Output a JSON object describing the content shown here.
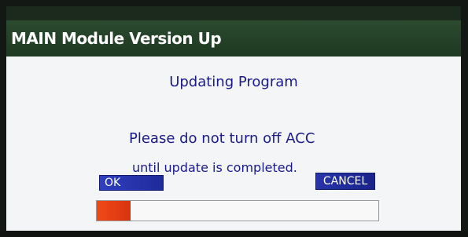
{
  "window": {
    "title": "MAIN Module Version Up"
  },
  "dialog": {
    "heading": "Updating Program",
    "message_line1": "Please do not turn off ACC",
    "message_line2": "until update is completed."
  },
  "buttons": {
    "ok_label": "OK",
    "cancel_label": "CANCEL"
  },
  "progress": {
    "value": 0.12
  },
  "colors": {
    "title_bar": "#1e3a22",
    "text": "#1a1a8a",
    "button": "#1f2a9a",
    "progress_fill": "#e0400f"
  }
}
